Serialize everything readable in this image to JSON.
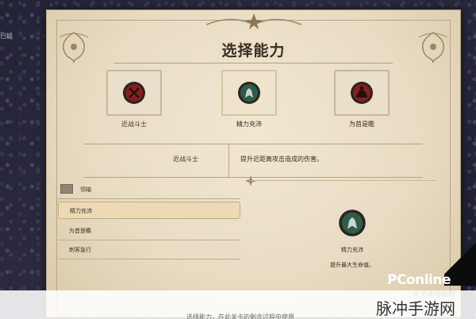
{
  "page": {
    "title": "选择能力",
    "side_label": "已锁"
  },
  "abilities": [
    {
      "label": "近战斗士",
      "icon": "crossed-swords-icon",
      "selected": false,
      "color": "#8a1d1d"
    },
    {
      "label": "精力充沛",
      "icon": "wolf-emblem-icon",
      "selected": true,
      "color": "#2f5c4a"
    },
    {
      "label": "为首是瞻",
      "icon": "rider-emblem-icon",
      "selected": false,
      "color": "#8a1d1d"
    }
  ],
  "description": {
    "name": "近战斗士",
    "text": "提升近距离攻击造成的伤害。"
  },
  "list": {
    "header": "领袖",
    "items": [
      {
        "label": "精力充沛",
        "active": true
      },
      {
        "label": "为首是瞻",
        "active": false
      },
      {
        "label": "刺客急行",
        "active": false
      }
    ]
  },
  "detail": {
    "name": "精力充沛",
    "subtitle": "提升最大生命值。",
    "icon": "wolf-emblem-icon"
  },
  "overlay": {
    "caption": "选择能力，在此关卡的剩余过程中使用",
    "brand": "PConline",
    "brand_sub": "太平洋电脑网",
    "watermark": "脉冲手游网"
  },
  "colors": {
    "parchment": "#e8dcc3",
    "ink": "#3a2e22",
    "accent_red": "#8a1d1d",
    "accent_green": "#2f5c4a"
  }
}
